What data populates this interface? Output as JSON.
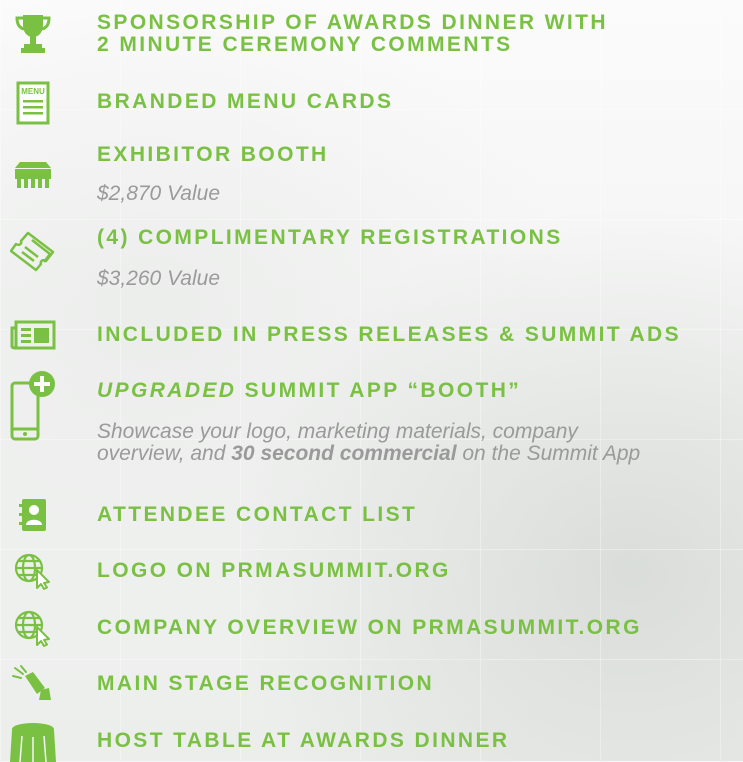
{
  "items": [
    {
      "title_line1": "SPONSORSHIP OF AWARDS DINNER WITH",
      "title_line2": "2 MINUTE CEREMONY COMMENTS",
      "icon": "trophy-icon"
    },
    {
      "title": "BRANDED MENU CARDS",
      "icon": "menu-card-icon",
      "icon_text": "MENU"
    },
    {
      "title": "EXHIBITOR BOOTH",
      "sub": "$2,870 Value",
      "icon": "booth-icon"
    },
    {
      "title": "(4) COMPLIMENTARY REGISTRATIONS",
      "sub": "$3,260 Value",
      "icon": "tickets-icon"
    },
    {
      "title": "INCLUDED IN PRESS RELEASES & SUMMIT ADS",
      "icon": "newspaper-icon"
    },
    {
      "title_em": "UPGRADED",
      "title_rest": " SUMMIT APP “BOOTH”",
      "sub_line1": "Showcase your logo, marketing materials, company",
      "sub_line2_pre": "overview, and ",
      "sub_line2_bold": "30 second commercial",
      "sub_line2_post": " on the Summit App",
      "icon": "phone-plus-icon"
    },
    {
      "title": "ATTENDEE CONTACT LIST",
      "icon": "contact-book-icon"
    },
    {
      "title": "LOGO ON PRMASUMMIT.ORG",
      "icon": "globe-cursor-icon"
    },
    {
      "title": "COMPANY OVERVIEW ON PRMASUMMIT.ORG",
      "icon": "globe-cursor-icon"
    },
    {
      "title": "MAIN STAGE RECOGNITION",
      "icon": "spotlight-icon"
    },
    {
      "title": "HOST TABLE AT AWARDS DINNER",
      "icon": "table-icon"
    }
  ],
  "colors": {
    "accent": "#7ac143",
    "subtext": "#9a9a9a"
  }
}
